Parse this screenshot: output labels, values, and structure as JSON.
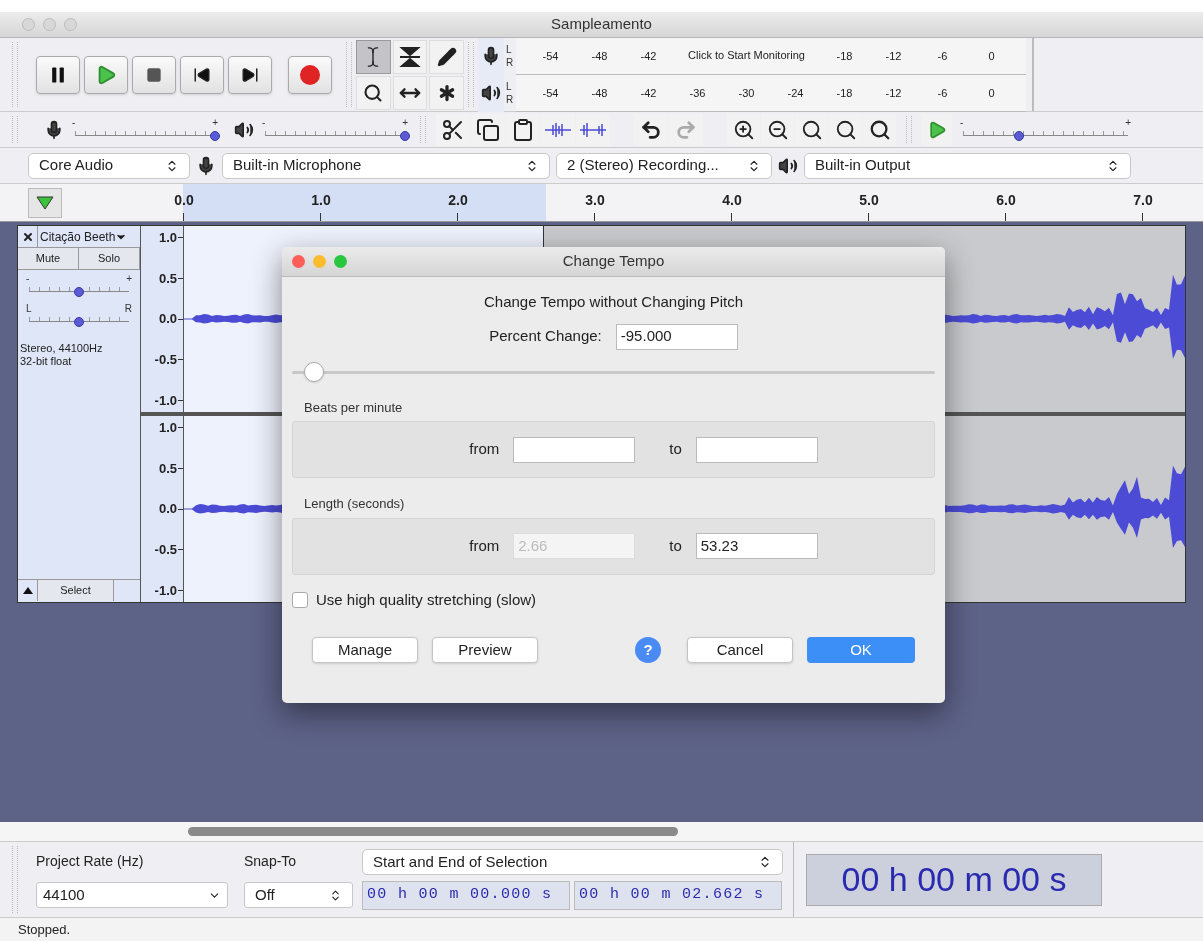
{
  "window": {
    "title": "Sampleamento"
  },
  "tools": [
    {
      "kind": "select",
      "selected": true
    },
    {
      "kind": "envelope",
      "selected": false
    },
    {
      "kind": "draw",
      "selected": false
    },
    {
      "kind": "zoom",
      "selected": false
    },
    {
      "kind": "timeshift",
      "selected": false
    },
    {
      "kind": "multi",
      "selected": false
    }
  ],
  "record_meter": {
    "channels": [
      "L",
      "R"
    ],
    "scale": [
      {
        "kind": "tick",
        "label": "-54"
      },
      {
        "kind": "tick",
        "label": "-48"
      },
      {
        "kind": "tick",
        "label": "-42"
      },
      {
        "kind": "message",
        "label": "Click to Start Monitoring"
      },
      {
        "kind": "tick",
        "label": "-18"
      },
      {
        "kind": "tick",
        "label": "-12"
      },
      {
        "kind": "tick",
        "label": "-6"
      },
      {
        "kind": "tick",
        "label": "0"
      }
    ]
  },
  "playback_meter": {
    "channels": [
      "L",
      "R"
    ],
    "scale": [
      {
        "kind": "tick",
        "label": "-54"
      },
      {
        "kind": "tick",
        "label": "-48"
      },
      {
        "kind": "tick",
        "label": "-42"
      },
      {
        "kind": "tick",
        "label": "-36"
      },
      {
        "kind": "tick",
        "label": "-30"
      },
      {
        "kind": "tick",
        "label": "-24"
      },
      {
        "kind": "tick",
        "label": "-18"
      },
      {
        "kind": "tick",
        "label": "-12"
      },
      {
        "kind": "tick",
        "label": "-6"
      },
      {
        "kind": "tick",
        "label": "0"
      }
    ]
  },
  "mixer": {
    "recording_volume": {
      "min": "-",
      "max": "+",
      "level": 1
    },
    "playback_volume": {
      "min": "-",
      "max": "+",
      "level": 1
    }
  },
  "play_at_speed": {
    "min": "-",
    "max": "+",
    "level": 0.34
  },
  "devices": {
    "host": "Core Audio",
    "input": "Built-in Microphone",
    "channels": "2 (Stereo) Recording...",
    "output": "Built-in Output"
  },
  "ruler": {
    "ticks": [
      "0.0",
      "1.0",
      "2.0",
      "3.0",
      "4.0",
      "5.0",
      "6.0",
      "7.0"
    ]
  },
  "track": {
    "name": "Citação Beeth",
    "buttons": [
      "Mute",
      "Solo"
    ],
    "gain": {
      "min": "-",
      "max": "+",
      "level": 0.5
    },
    "pan": {
      "min": "L",
      "max": "R",
      "level": 0.5
    },
    "info": [
      "Stereo, 44100Hz",
      "32-bit float"
    ],
    "select": "Select",
    "channels": [
      {
        "scale": [
          "1.0",
          "0.5",
          "0.0",
          "-0.5",
          "-1.0"
        ]
      },
      {
        "scale": [
          "1.0",
          "0.5",
          "0.0",
          "-0.5",
          "-1.0"
        ]
      }
    ]
  },
  "dialog": {
    "title": "Change Tempo",
    "heading": "Change Tempo without Changing Pitch",
    "percent_change": {
      "label": "Percent Change:",
      "value": "-95.000"
    },
    "slider": {
      "level": 0.02
    },
    "sections": [
      {
        "title": "Beats per minute",
        "fields": [
          {
            "label": "from",
            "disabled": false
          },
          {
            "label": "to",
            "disabled": false
          }
        ]
      },
      {
        "title": "Length (seconds)",
        "fields": [
          {
            "label": "from",
            "value": "2.66",
            "disabled": true
          },
          {
            "label": "to",
            "value": "53.23",
            "disabled": false
          }
        ]
      }
    ],
    "checkbox": {
      "label": "Use high quality stretching (slow)",
      "checked": false
    },
    "buttons": [
      {
        "kind": "button",
        "label": "Manage"
      },
      {
        "kind": "button",
        "label": "Preview"
      },
      {
        "kind": "help",
        "label": "?"
      },
      {
        "kind": "button",
        "label": "Cancel"
      },
      {
        "kind": "default",
        "label": "OK"
      }
    ]
  },
  "selection_toolbar": {
    "project_rate": {
      "label": "Project Rate (Hz)",
      "value": "44100"
    },
    "snap_to": {
      "label": "Snap-To",
      "value": "Off"
    },
    "selection_format": "Start and End of Selection",
    "start_time": "00 h 00 m 00.000 s",
    "end_time": "00 h 00 m 02.662 s",
    "audio_position": "00 h 00 m 00 s"
  },
  "status_bar": {
    "text": "Stopped."
  }
}
